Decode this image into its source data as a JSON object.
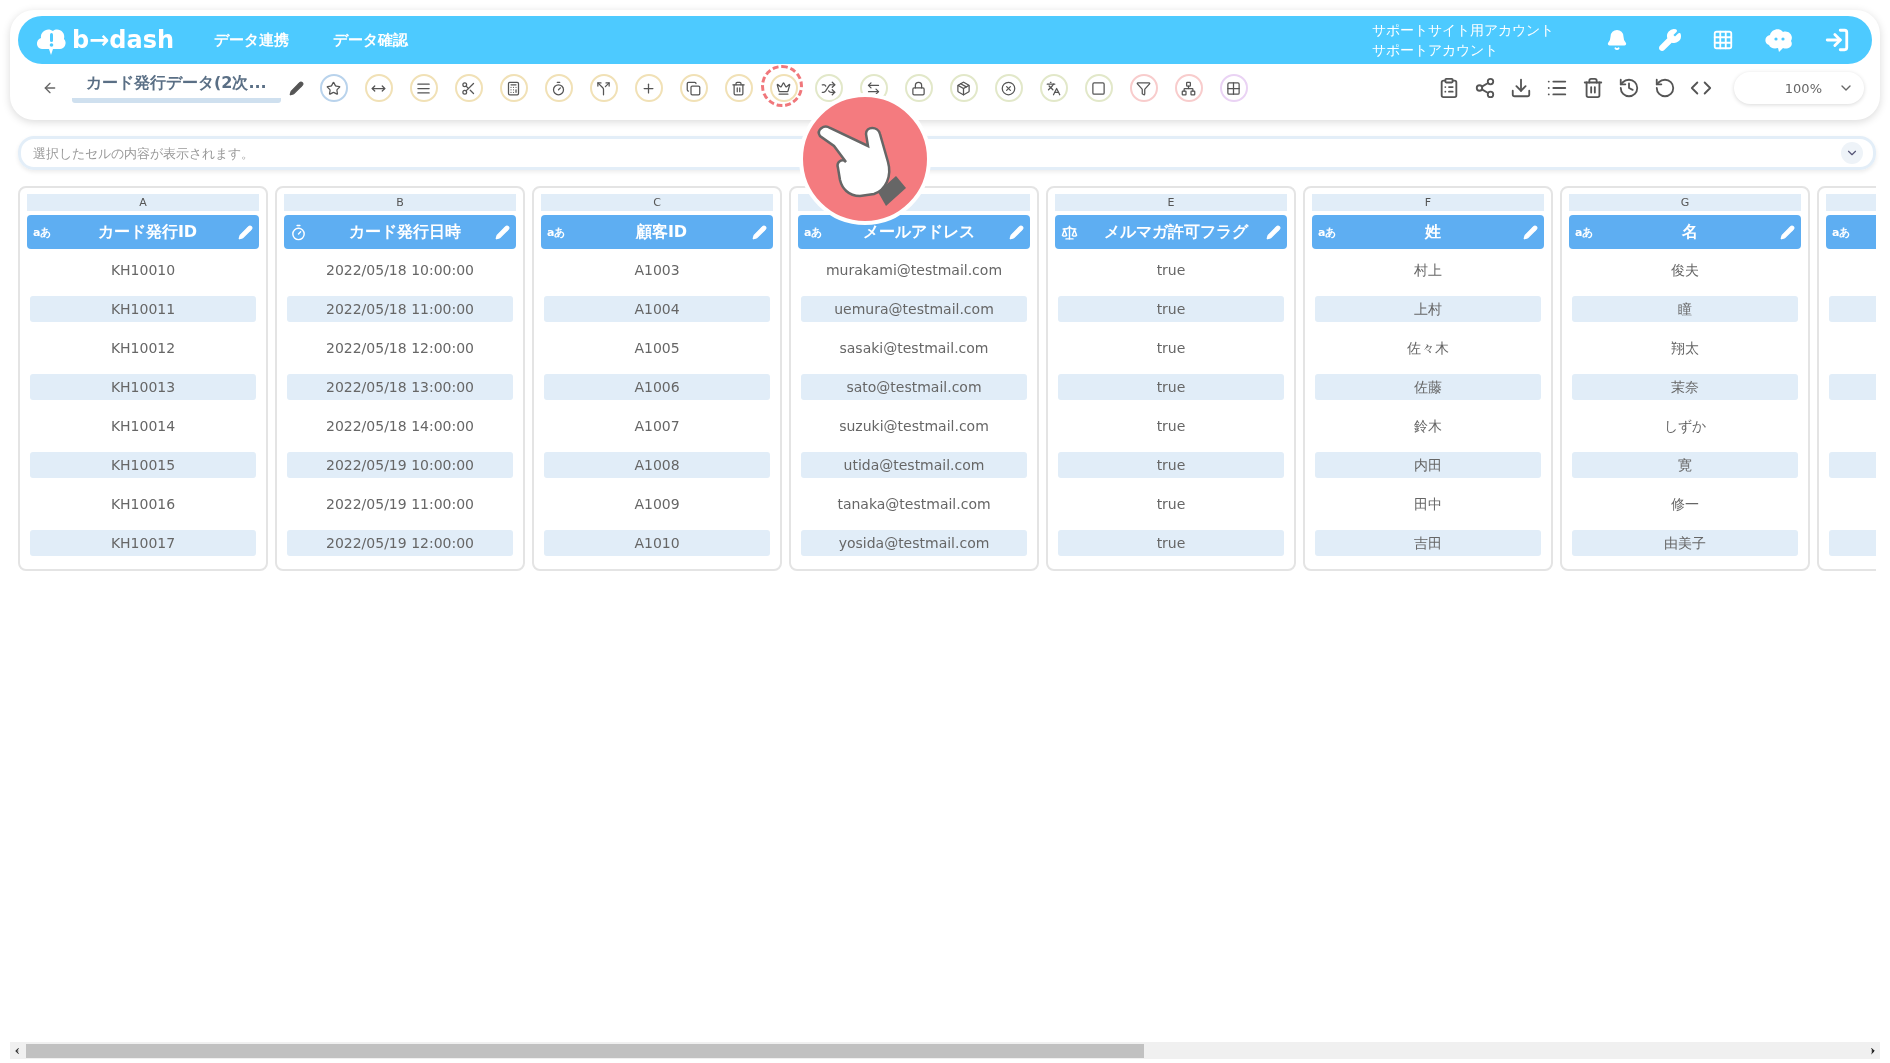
{
  "header": {
    "logo": "b→dash",
    "nav": [
      {
        "label": "データ連携"
      },
      {
        "label": "データ確認"
      }
    ],
    "account": [
      "サポートサイト用アカウント",
      "サポートアカウント"
    ]
  },
  "toolbar": {
    "title": "カード発行データ(2次...",
    "zoom": "100%",
    "tools": [
      {
        "color": "#b9d3ec",
        "highlighted": false
      },
      {
        "color": "#f1e1b6",
        "highlighted": false
      },
      {
        "color": "#f1e1b6",
        "highlighted": false
      },
      {
        "color": "#f1e1b6",
        "highlighted": false
      },
      {
        "color": "#f1e1b6",
        "highlighted": false
      },
      {
        "color": "#f1e1b6",
        "highlighted": false
      },
      {
        "color": "#f1e1b6",
        "highlighted": false
      },
      {
        "color": "#f1e1b6",
        "highlighted": false
      },
      {
        "color": "#f1e1b6",
        "highlighted": false
      },
      {
        "color": "#f1e1b6",
        "highlighted": false
      },
      {
        "color": "#f1e1b6",
        "highlighted": true
      },
      {
        "color": "#e2e8c9",
        "highlighted": false
      },
      {
        "color": "#e2e8c9",
        "highlighted": false
      },
      {
        "color": "#e2e8c9",
        "highlighted": false
      },
      {
        "color": "#e2e8c9",
        "highlighted": false
      },
      {
        "color": "#e2e8c9",
        "highlighted": false
      },
      {
        "color": "#e2e8c9",
        "highlighted": false
      },
      {
        "color": "#e2e8c9",
        "highlighted": false
      },
      {
        "color": "#f8cccc",
        "highlighted": false
      },
      {
        "color": "#f8cccc",
        "highlighted": false
      },
      {
        "color": "#ead3f4",
        "highlighted": false
      }
    ]
  },
  "formula_bar": {
    "placeholder": "選択したセルの内容が表示されます。"
  },
  "columns": [
    {
      "letter": "A",
      "name": "カード発行ID",
      "kind": "text",
      "type_label": "aあ",
      "cells": [
        "KH10010",
        "KH10011",
        "KH10012",
        "KH10013",
        "KH10014",
        "KH10015",
        "KH10016",
        "KH10017"
      ]
    },
    {
      "letter": "B",
      "name": "カード発行日時",
      "kind": "datetime",
      "cells": [
        "2022/05/18 10:00:00",
        "2022/05/18 11:00:00",
        "2022/05/18 12:00:00",
        "2022/05/18 13:00:00",
        "2022/05/18 14:00:00",
        "2022/05/19 10:00:00",
        "2022/05/19 11:00:00",
        "2022/05/19 12:00:00"
      ]
    },
    {
      "letter": "C",
      "name": "顧客ID",
      "kind": "text",
      "type_label": "aあ",
      "cells": [
        "A1003",
        "A1004",
        "A1005",
        "A1006",
        "A1007",
        "A1008",
        "A1009",
        "A1010"
      ]
    },
    {
      "name": "メールアドレス",
      "kind": "text",
      "type_label": "aあ",
      "cells": [
        "murakami@testmail.com",
        "uemura@testmail.com",
        "sasaki@testmail.com",
        "sato@testmail.com",
        "suzuki@testmail.com",
        "utida@testmail.com",
        "tanaka@testmail.com",
        "yosida@testmail.com"
      ]
    },
    {
      "letter": "E",
      "name": "メルマガ許可フラグ",
      "kind": "boolean",
      "cells": [
        "true",
        "true",
        "true",
        "true",
        "true",
        "true",
        "true",
        "true"
      ]
    },
    {
      "letter": "F",
      "name": "姓",
      "kind": "text",
      "type_label": "aあ",
      "cells": [
        "村上",
        "上村",
        "佐々木",
        "佐藤",
        "鈴木",
        "内田",
        "田中",
        "吉田"
      ]
    },
    {
      "letter": "G",
      "name": "名",
      "kind": "text",
      "type_label": "aあ",
      "cells": [
        "俊夫",
        "瞳",
        "翔太",
        "茉奈",
        "しずか",
        "寛",
        "修一",
        "由美子"
      ]
    },
    {
      "kind": "text",
      "type_label": "aあ"
    }
  ]
}
